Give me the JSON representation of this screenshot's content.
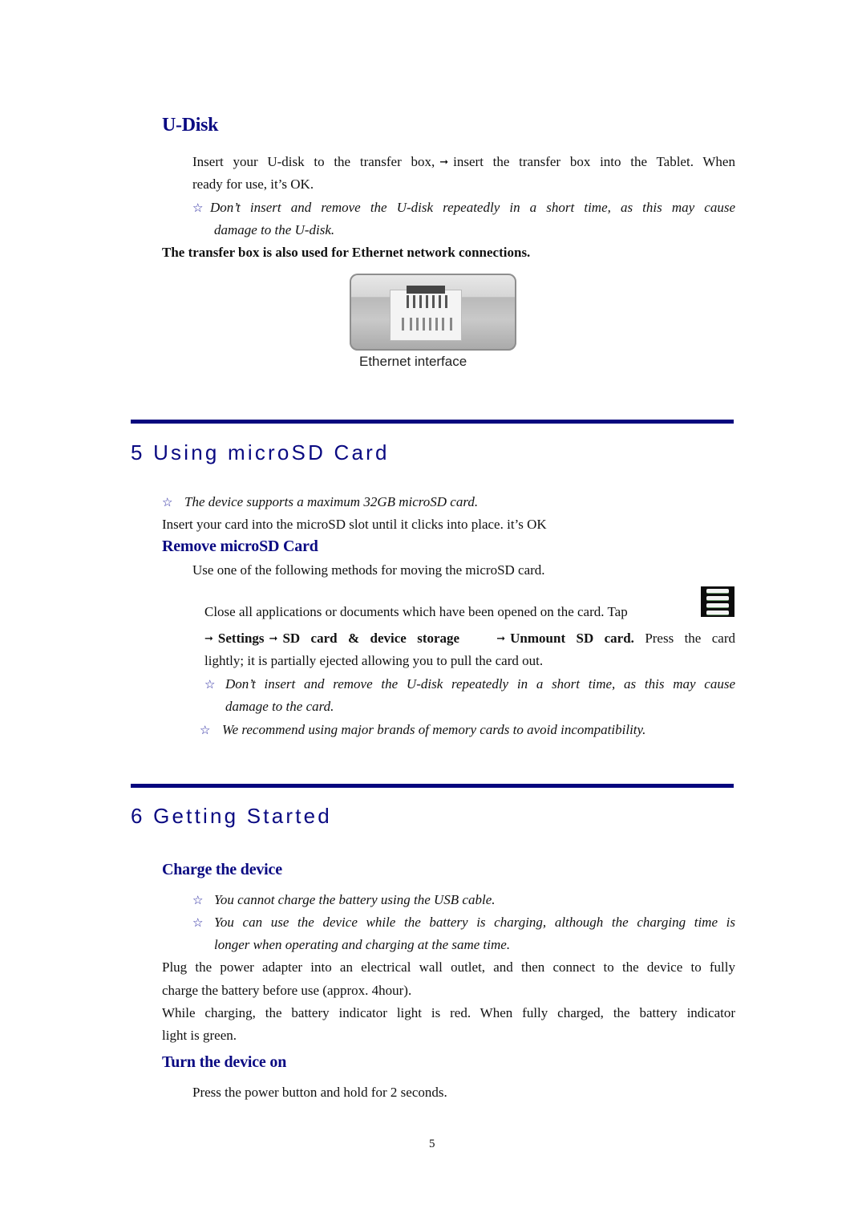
{
  "udisk": {
    "heading": "U-Disk",
    "para_line1_a": "Insert your U-disk to the transfer box,",
    "para_line1_b": "insert the transfer box into the Tablet. When",
    "para_line2": "ready for use, it’s OK.",
    "note_line1": "Don’t insert and remove the U-disk repeatedly in a short time, as this may cause",
    "note_line2": "damage to the U-disk.",
    "bold_note": "The transfer box is also used for Ethernet network connections.",
    "image_caption": "Ethernet interface"
  },
  "section5": {
    "title": "5 Using microSD Card",
    "note": "The device supports a maximum 32GB microSD card.",
    "insert_text": "Insert your card into the microSD slot until it clicks into place. it’s OK",
    "remove": {
      "heading": "Remove microSD Card",
      "intro": "Use one of the following methods for moving the microSD card.",
      "step_line1": "Close all applications or documents which have been opened on the card. Tap",
      "path": [
        "Settings",
        "SD card & device storage",
        "Unmount SD card."
      ],
      "step_line2_tail": "Press the card",
      "step_line3": "lightly; it is partially ejected allowing you to pull the card out.",
      "note1_line1": "Don’t insert and remove the U-disk repeatedly in a short time, as this may cause",
      "note1_line2": "damage to the card.",
      "note2": "We recommend using major brands of memory cards to avoid incompatibility."
    }
  },
  "section6": {
    "title": "6 Getting Started",
    "charge": {
      "heading": "Charge the device",
      "note1": "You cannot charge the battery using the USB cable.",
      "note2_line1": "You can use the device while the battery is charging, although the charging time is",
      "note2_line2": "longer when operating and charging at the same time.",
      "para1_line1": "Plug the power adapter into an electrical wall outlet, and then connect to the device to fully",
      "para1_line2": "charge the battery before use (approx. 4hour).",
      "para2_line1": "While charging, the battery indicator light is red. When fully charged, the battery indicator",
      "para2_line2": "light is green."
    },
    "turn_on": {
      "heading": "Turn the device on",
      "text": "Press the power button and hold for 2 seconds."
    }
  },
  "icons": {
    "star": "☆",
    "arrow": "➞"
  },
  "footer": {
    "page_number": "5"
  }
}
